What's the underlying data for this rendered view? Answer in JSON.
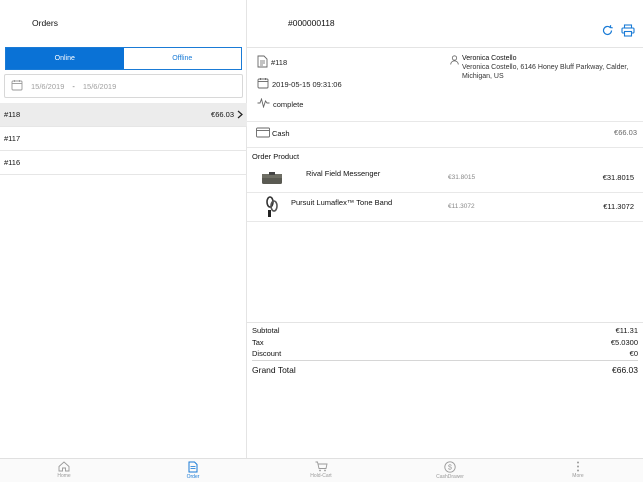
{
  "left": {
    "title": "Orders",
    "tabs": {
      "online": "Online",
      "offline": "Offline"
    },
    "date_from": "15/6/2019",
    "date_sep": "-",
    "date_to": "15/6/2019",
    "orders": [
      {
        "id": "#118",
        "amount": "€66.03",
        "selected": true
      },
      {
        "id": "#117",
        "amount": ""
      },
      {
        "id": "#116",
        "amount": ""
      }
    ]
  },
  "detail": {
    "header_id": "#000000118",
    "order_no": "#118",
    "date": "2019-05-15 09:31:06",
    "status": "complete",
    "customer_name": "Veronica Costello",
    "customer_address": "Veronica Costello, 6146 Honey Bluff Parkway, Calder, Michigan, US",
    "payment_method": "Cash",
    "payment_amount": "€66.03",
    "order_product_title": "Order Product",
    "products": [
      {
        "name": "Rival Field Messenger",
        "price": "€31.8015",
        "total": "€31.8015"
      },
      {
        "name": "Pursuit Lumaflex™ Tone Band",
        "price": "€11.3072",
        "total": "€11.3072"
      }
    ],
    "summary": {
      "subtotal_label": "Subtotal",
      "subtotal": "€11.31",
      "tax_label": "Tax",
      "tax": "€5.0300",
      "discount_label": "Discount",
      "discount": "€0",
      "grand_total_label": "Grand Total",
      "grand_total": "€66.03"
    }
  },
  "tabbar": {
    "home": "Home",
    "order": "Order",
    "hold_cart": "Hold-Cart",
    "cash_drawer": "CashDrawer",
    "more": "More"
  },
  "colors": {
    "accent": "#0a72d6"
  }
}
